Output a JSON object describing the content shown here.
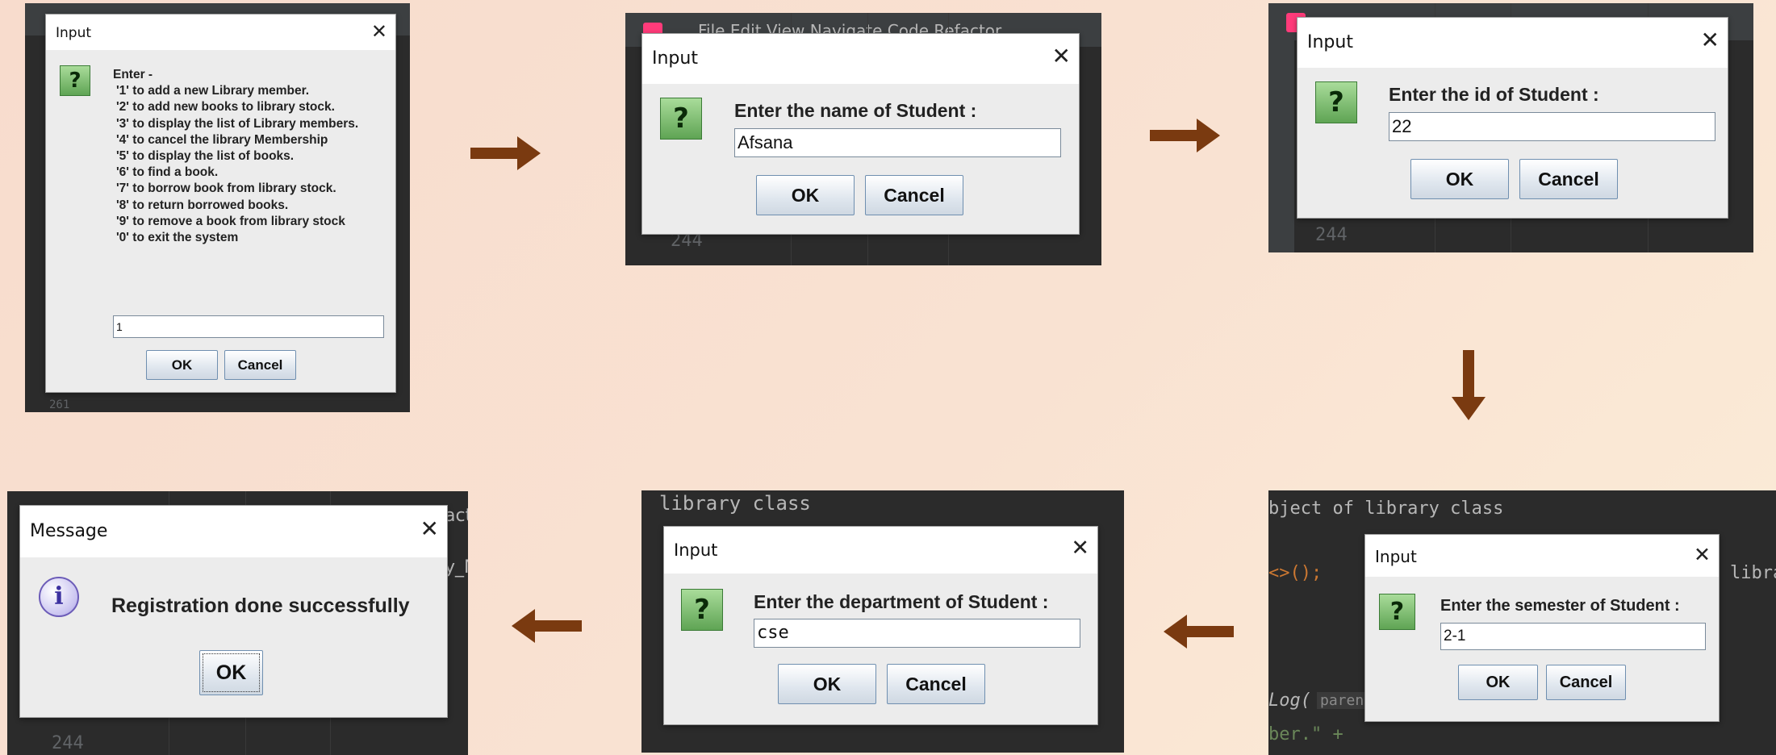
{
  "colors": {
    "background": "#f8dccd",
    "arrow": "#7a3a10",
    "ide": "#2b2b2b",
    "dialog": "#ececec"
  },
  "dialog1": {
    "title": "Input",
    "icon": "question-icon",
    "prompt_heading": "Enter -",
    "menu_items": [
      "'1' to add a new Library member.",
      "'2' to add new books to library stock.",
      "'3' to display the list of Library members.",
      "'4' to cancel the library Membership",
      "'5' to display the list of books.",
      "'6' to find a book.",
      "'7' to borrow book from library stock.",
      "'8' to return borrowed books.",
      "'9' to remove a book from library stock",
      "'0' to exit the system"
    ],
    "input_value": "1",
    "ok_label": "OK",
    "cancel_label": "Cancel",
    "bg_line": "261"
  },
  "dialog2": {
    "title": "Input",
    "icon": "question-icon",
    "prompt": "Enter the name of Student :",
    "input_value": "Afsana",
    "ok_label": "OK",
    "cancel_label": "Cancel",
    "bg_menu": "File  Edit  View  Navigate  Code  Refactor",
    "bg_line": "244"
  },
  "dialog3": {
    "title": "Input",
    "icon": "question-icon",
    "prompt": "Enter the id of Student :",
    "input_value": "22",
    "ok_label": "OK",
    "cancel_label": "Cancel",
    "bg_line": "244"
  },
  "dialog4": {
    "title": "Input",
    "icon": "question-icon",
    "prompt": "Enter the semester of Student :",
    "input_value": "2-1",
    "ok_label": "OK",
    "cancel_label": "Cancel",
    "bg_code_top": "bject of library class",
    "bg_code_mid": "<>();",
    "bg_code_right": "libra",
    "bg_code_log": "Log(",
    "bg_code_param": "parent",
    "bg_code_bottom": "ber.\" +"
  },
  "dialog5": {
    "title": "Input",
    "icon": "question-icon",
    "prompt": "Enter the department of Student :",
    "input_value": "cse",
    "ok_label": "OK",
    "cancel_label": "Cancel",
    "bg_code_top": "library class"
  },
  "dialog6": {
    "title": "Message",
    "icon": "info-icon",
    "message": "Registration done successfully",
    "ok_label": "OK",
    "bg_text_1": "act",
    "bg_text_2": "y_M",
    "bg_line": "244"
  }
}
